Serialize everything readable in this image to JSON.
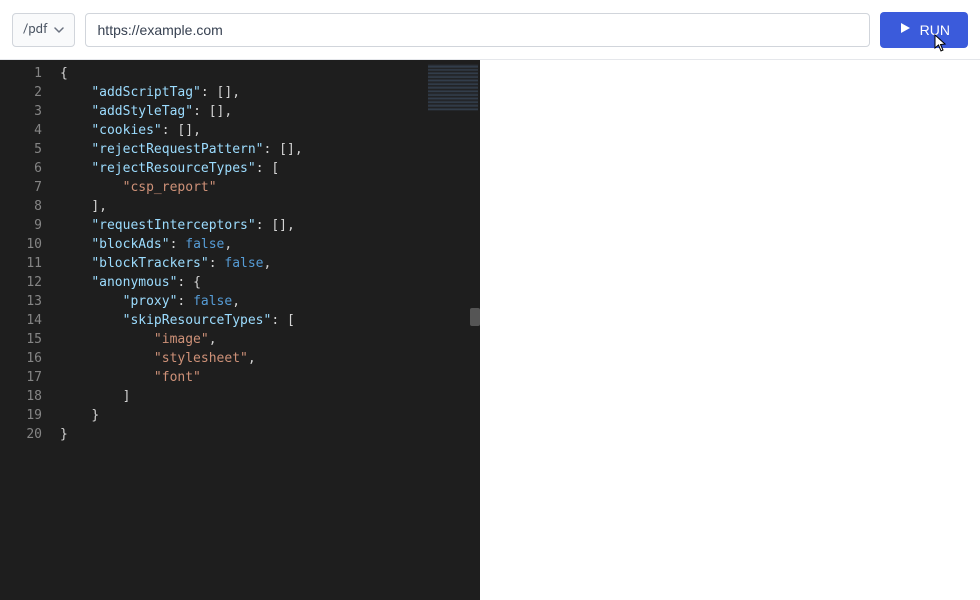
{
  "toolbar": {
    "dropdown_value": "/pdf",
    "url_value": "https://example.com",
    "run_label": "RUN"
  },
  "editor": {
    "line_numbers": [
      1,
      2,
      3,
      4,
      5,
      6,
      7,
      8,
      9,
      10,
      11,
      12,
      13,
      14,
      15,
      16,
      17,
      18,
      19,
      20
    ],
    "json_content": {
      "addScriptTag": [],
      "addStyleTag": [],
      "cookies": [],
      "rejectRequestPattern": [],
      "rejectResourceTypes": [
        "csp_report"
      ],
      "requestInterceptors": [],
      "blockAds": false,
      "blockTrackers": false,
      "anonymous": {
        "proxy": false,
        "skipResourceTypes": [
          "image",
          "stylesheet",
          "font"
        ]
      }
    },
    "tokens": [
      [
        {
          "t": "brace",
          "v": "{"
        }
      ],
      [
        {
          "t": "indent",
          "v": "    "
        },
        {
          "t": "key",
          "v": "\"addScriptTag\""
        },
        {
          "t": "colon",
          "v": ": "
        },
        {
          "t": "bracket",
          "v": "[]"
        },
        {
          "t": "comma",
          "v": ","
        }
      ],
      [
        {
          "t": "indent",
          "v": "    "
        },
        {
          "t": "key",
          "v": "\"addStyleTag\""
        },
        {
          "t": "colon",
          "v": ": "
        },
        {
          "t": "bracket",
          "v": "[]"
        },
        {
          "t": "comma",
          "v": ","
        }
      ],
      [
        {
          "t": "indent",
          "v": "    "
        },
        {
          "t": "key",
          "v": "\"cookies\""
        },
        {
          "t": "colon",
          "v": ": "
        },
        {
          "t": "bracket",
          "v": "[]"
        },
        {
          "t": "comma",
          "v": ","
        }
      ],
      [
        {
          "t": "indent",
          "v": "    "
        },
        {
          "t": "key",
          "v": "\"rejectRequestPattern\""
        },
        {
          "t": "colon",
          "v": ": "
        },
        {
          "t": "bracket",
          "v": "[]"
        },
        {
          "t": "comma",
          "v": ","
        }
      ],
      [
        {
          "t": "indent",
          "v": "    "
        },
        {
          "t": "key",
          "v": "\"rejectResourceTypes\""
        },
        {
          "t": "colon",
          "v": ": "
        },
        {
          "t": "bracket",
          "v": "["
        }
      ],
      [
        {
          "t": "indent",
          "v": "        "
        },
        {
          "t": "str",
          "v": "\"csp_report\""
        }
      ],
      [
        {
          "t": "indent",
          "v": "    "
        },
        {
          "t": "bracket",
          "v": "]"
        },
        {
          "t": "comma",
          "v": ","
        }
      ],
      [
        {
          "t": "indent",
          "v": "    "
        },
        {
          "t": "key",
          "v": "\"requestInterceptors\""
        },
        {
          "t": "colon",
          "v": ": "
        },
        {
          "t": "bracket",
          "v": "[]"
        },
        {
          "t": "comma",
          "v": ","
        }
      ],
      [
        {
          "t": "indent",
          "v": "    "
        },
        {
          "t": "key",
          "v": "\"blockAds\""
        },
        {
          "t": "colon",
          "v": ": "
        },
        {
          "t": "bool",
          "v": "false"
        },
        {
          "t": "comma",
          "v": ","
        }
      ],
      [
        {
          "t": "indent",
          "v": "    "
        },
        {
          "t": "key",
          "v": "\"blockTrackers\""
        },
        {
          "t": "colon",
          "v": ": "
        },
        {
          "t": "bool",
          "v": "false"
        },
        {
          "t": "comma",
          "v": ","
        }
      ],
      [
        {
          "t": "indent",
          "v": "    "
        },
        {
          "t": "key",
          "v": "\"anonymous\""
        },
        {
          "t": "colon",
          "v": ": "
        },
        {
          "t": "brace",
          "v": "{"
        }
      ],
      [
        {
          "t": "indent",
          "v": "        "
        },
        {
          "t": "key",
          "v": "\"proxy\""
        },
        {
          "t": "colon",
          "v": ": "
        },
        {
          "t": "bool",
          "v": "false"
        },
        {
          "t": "comma",
          "v": ","
        }
      ],
      [
        {
          "t": "indent",
          "v": "        "
        },
        {
          "t": "key",
          "v": "\"skipResourceTypes\""
        },
        {
          "t": "colon",
          "v": ": "
        },
        {
          "t": "bracket",
          "v": "["
        }
      ],
      [
        {
          "t": "indent",
          "v": "            "
        },
        {
          "t": "str",
          "v": "\"image\""
        },
        {
          "t": "comma",
          "v": ","
        }
      ],
      [
        {
          "t": "indent",
          "v": "            "
        },
        {
          "t": "str",
          "v": "\"stylesheet\""
        },
        {
          "t": "comma",
          "v": ","
        }
      ],
      [
        {
          "t": "indent",
          "v": "            "
        },
        {
          "t": "str",
          "v": "\"font\""
        }
      ],
      [
        {
          "t": "indent",
          "v": "        "
        },
        {
          "t": "bracket",
          "v": "]"
        }
      ],
      [
        {
          "t": "indent",
          "v": "    "
        },
        {
          "t": "brace",
          "v": "}"
        }
      ],
      [
        {
          "t": "brace",
          "v": "}"
        }
      ]
    ]
  }
}
